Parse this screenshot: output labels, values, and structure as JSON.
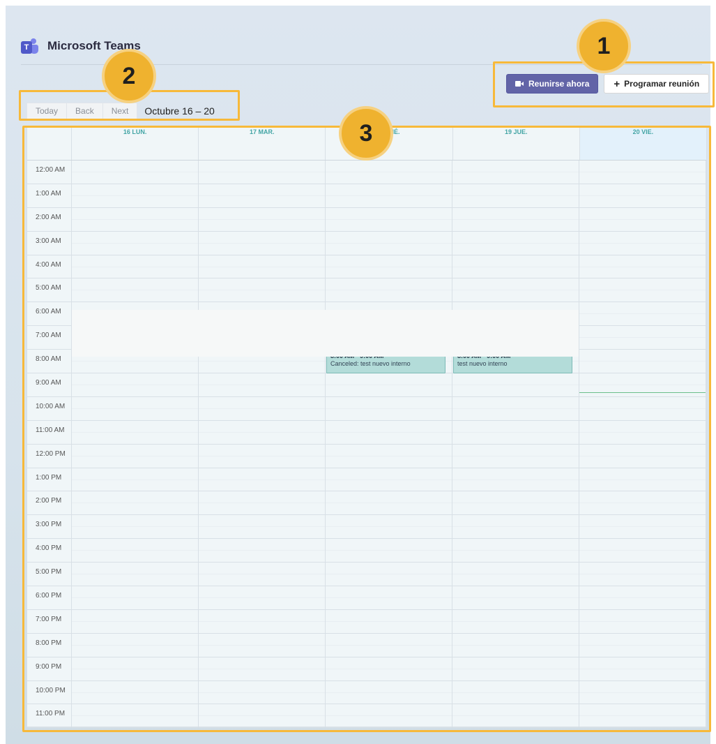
{
  "app": {
    "title": "Microsoft Teams",
    "logo_letter": "T"
  },
  "actions": {
    "meet_now_label": "Reunirse ahora",
    "schedule_label": "Programar reunión"
  },
  "nav": {
    "today_label": "Today",
    "back_label": "Back",
    "next_label": "Next",
    "range_label": "Octubre 16 – 20"
  },
  "calendar": {
    "days": [
      "16 LUN.",
      "17 MAR.",
      "18 MIÉ.",
      "19 JUE.",
      "20 VIE."
    ],
    "hours": [
      "12:00 AM",
      "1:00 AM",
      "2:00 AM",
      "3:00 AM",
      "4:00 AM",
      "5:00 AM",
      "6:00 AM",
      "7:00 AM",
      "8:00 AM",
      "9:00 AM",
      "10:00 AM",
      "11:00 AM",
      "12:00 PM",
      "1:00 PM",
      "2:00 PM",
      "3:00 PM",
      "4:00 PM",
      "5:00 PM",
      "6:00 PM",
      "7:00 PM",
      "8:00 PM",
      "9:00 PM",
      "10:00 PM",
      "11:00 PM"
    ],
    "events": [
      {
        "day": "18 MIÉ.",
        "time": "8:00 AM - 9:00 AM",
        "title": "Canceled: test nuevo interno"
      },
      {
        "day": "19 JUE.",
        "time": "8:00 AM - 9:00 AM",
        "title": "test nuevo interno"
      }
    ]
  },
  "annotations": {
    "badge_1": "1",
    "badge_2": "2",
    "badge_3": "3",
    "highlight_color": "#f7b93a"
  },
  "colors": {
    "primary_button": "#6264a7",
    "day_header_text": "#43a5a5",
    "event_fill": "#b3dcd9",
    "today_column": "#e3f1fb",
    "now_line": "#6bbf8a"
  }
}
